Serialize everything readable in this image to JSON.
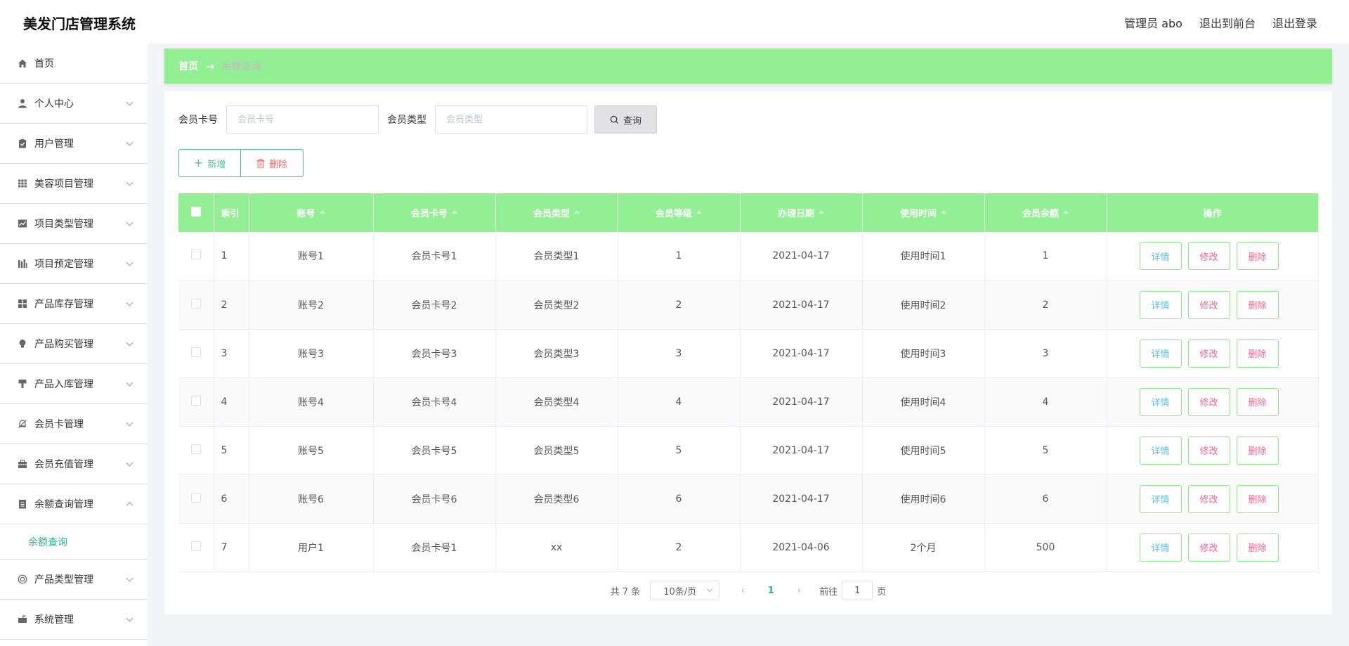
{
  "header": {
    "app_title": "美发门店管理系统",
    "user_label": "管理员 abo",
    "front_link": "退出到前台",
    "logout_link": "退出登录"
  },
  "sidebar": {
    "items": [
      {
        "label": "首页",
        "icon": "home-icon"
      },
      {
        "label": "个人中心",
        "icon": "user-icon"
      },
      {
        "label": "用户管理",
        "icon": "clipboard-icon"
      },
      {
        "label": "美容项目管理",
        "icon": "grid-icon"
      },
      {
        "label": "项目类型管理",
        "icon": "chart-icon"
      },
      {
        "label": "项目预定管理",
        "icon": "bar-chart-icon"
      },
      {
        "label": "产品库存管理",
        "icon": "apps-icon"
      },
      {
        "label": "产品购买管理",
        "icon": "bulb-icon"
      },
      {
        "label": "产品入库管理",
        "icon": "brush-icon"
      },
      {
        "label": "会员卡管理",
        "icon": "bell-off-icon"
      },
      {
        "label": "会员充值管理",
        "icon": "briefcase-icon"
      },
      {
        "label": "余额查询管理",
        "icon": "document-icon"
      },
      {
        "label": "产品类型管理",
        "icon": "lifebuoy-icon"
      },
      {
        "label": "系统管理",
        "icon": "mailbox-icon"
      }
    ],
    "sub_item": "余额查询"
  },
  "breadcrumb": {
    "home": "首页",
    "arrow": "→",
    "current": "余额查询"
  },
  "search": {
    "card_label": "会员卡号",
    "card_placeholder": "会员卡号",
    "type_label": "会员类型",
    "type_placeholder": "会员类型",
    "button": "查询"
  },
  "actions": {
    "add": "新增",
    "delete": "删除"
  },
  "table": {
    "headers": [
      "索引",
      "账号",
      "会员卡号",
      "会员类型",
      "会员等级",
      "办理日期",
      "使用时间",
      "会员余额",
      "操作"
    ],
    "rows": [
      [
        "1",
        "账号1",
        "会员卡号1",
        "会员类型1",
        "1",
        "2021-04-17",
        "使用时间1",
        "1"
      ],
      [
        "2",
        "账号2",
        "会员卡号2",
        "会员类型2",
        "2",
        "2021-04-17",
        "使用时间2",
        "2"
      ],
      [
        "3",
        "账号3",
        "会员卡号3",
        "会员类型3",
        "3",
        "2021-04-17",
        "使用时间3",
        "3"
      ],
      [
        "4",
        "账号4",
        "会员卡号4",
        "会员类型4",
        "4",
        "2021-04-17",
        "使用时间4",
        "4"
      ],
      [
        "5",
        "账号5",
        "会员卡号5",
        "会员类型5",
        "5",
        "2021-04-17",
        "使用时间5",
        "5"
      ],
      [
        "6",
        "账号6",
        "会员卡号6",
        "会员类型6",
        "6",
        "2021-04-17",
        "使用时间6",
        "6"
      ],
      [
        "7",
        "用户1",
        "会员卡号1",
        "xx",
        "2",
        "2021-04-06",
        "2个月",
        "500"
      ]
    ],
    "row_buttons": {
      "detail": "详情",
      "edit": "修改",
      "delete": "删除"
    }
  },
  "pagination": {
    "total": "共 7 条",
    "page_size": "10条/页",
    "current_page": "1",
    "goto_label": "前往",
    "goto_value": "1",
    "page_suffix": "页"
  },
  "colors": {
    "accent_green": "#93ef93",
    "active_text": "#2cb38a",
    "danger": "#f56c6c"
  }
}
